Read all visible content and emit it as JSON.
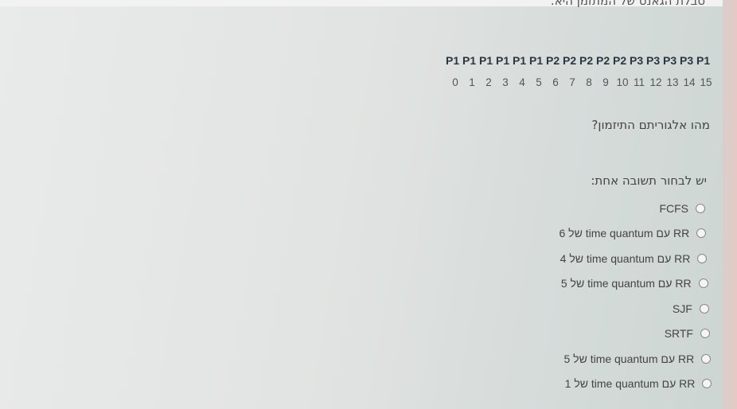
{
  "header_cutoff_text": "טבלת הגאנט של המתזמן היא:",
  "gantt": {
    "labels": [
      "P1",
      "P1",
      "P1",
      "P1",
      "P1",
      "P1",
      "P2",
      "P2",
      "P2",
      "P2",
      "P2",
      "P3",
      "P3",
      "P3",
      "P3",
      "P1"
    ],
    "ticks": [
      "0",
      "1",
      "2",
      "3",
      "4",
      "5",
      "6",
      "7",
      "8",
      "9",
      "10",
      "11",
      "12",
      "13",
      "14",
      "15"
    ]
  },
  "question": "מהו אלגוריתם התיזמון?",
  "instruction": "יש לבחור תשובה אחת:",
  "options": [
    {
      "label": "FCFS",
      "selected": false
    },
    {
      "label": "RR עם time quantum של 6",
      "selected": false
    },
    {
      "label": "RR עם time quantum של 4",
      "selected": false
    },
    {
      "label": "RR עם time quantum של 5",
      "selected": false
    },
    {
      "label": "SJF",
      "selected": false
    },
    {
      "label": "SRTF",
      "selected": false
    },
    {
      "label": "RR עם time quantum של 5",
      "selected": false
    },
    {
      "label": "RR עם time quantum של 1",
      "selected": false
    }
  ]
}
